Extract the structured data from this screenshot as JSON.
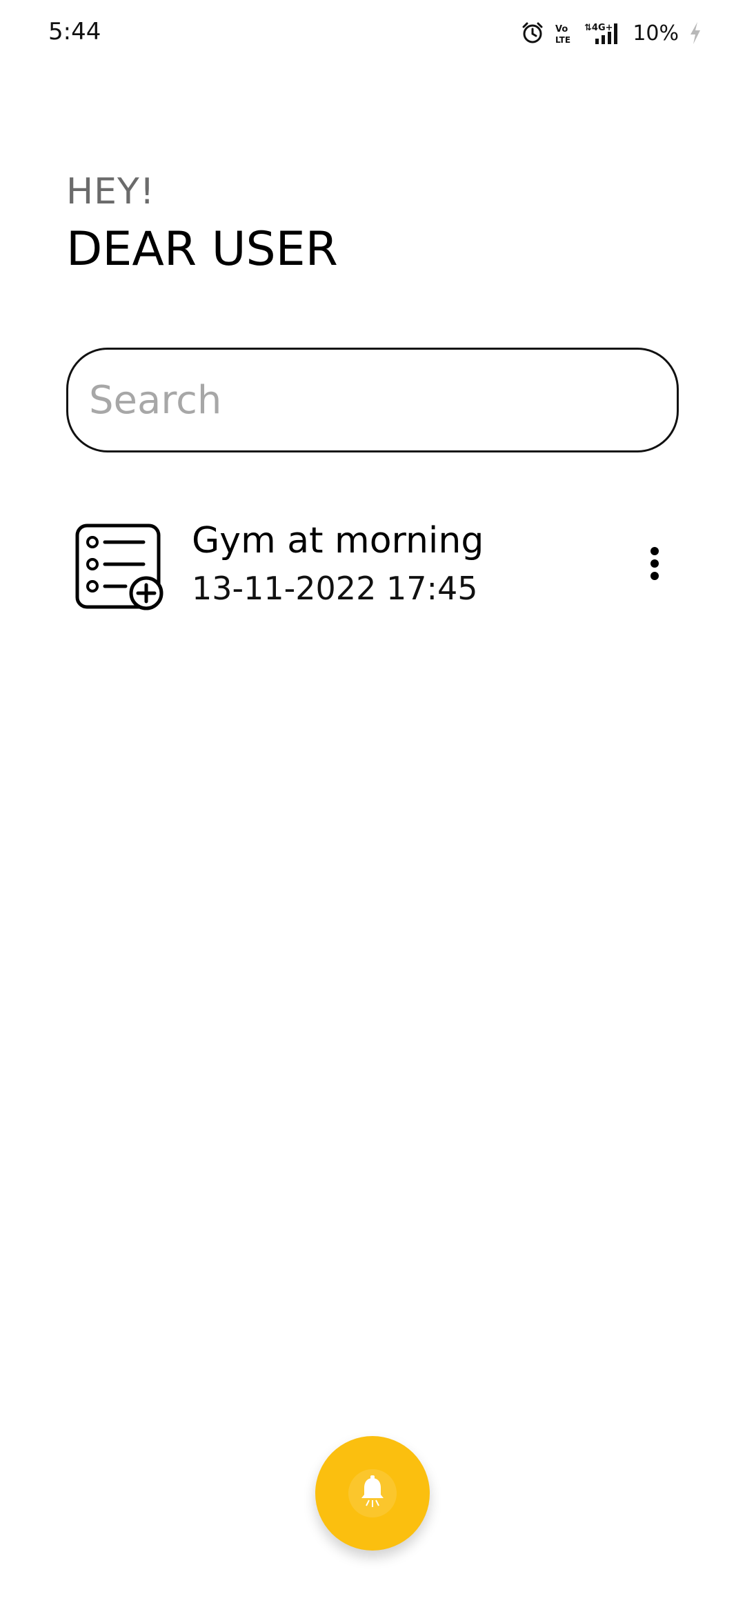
{
  "status_bar": {
    "time": "5:44",
    "network": "4G+",
    "volte": "Vo LTE",
    "battery": "10%"
  },
  "greeting": {
    "subtitle": "HEY!",
    "title": "DEAR USER"
  },
  "search": {
    "placeholder": "Search",
    "value": ""
  },
  "reminders": [
    {
      "title": "Gym at morning",
      "datetime": "13-11-2022 17:45",
      "icon": "task-list-add-icon"
    }
  ],
  "fab": {
    "icon": "bell-icon",
    "color": "#fbbf0f"
  }
}
